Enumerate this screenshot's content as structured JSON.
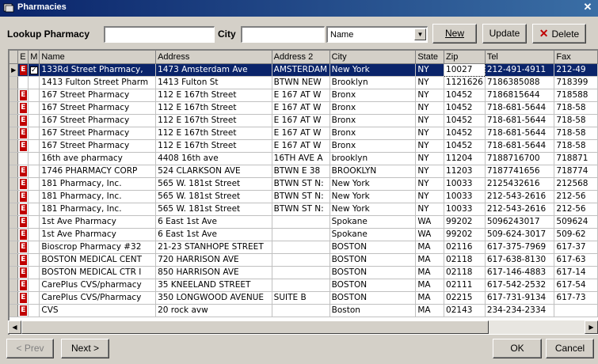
{
  "window": {
    "title": "Pharmacies",
    "close_glyph": "✕"
  },
  "lookup": {
    "label": "Lookup Pharmacy",
    "value": "",
    "city_label": "City",
    "city_value": "",
    "sort_value": "Name"
  },
  "buttons": {
    "new": "New",
    "update": "Update",
    "delete": "Delete",
    "prev": "< Prev",
    "next": "Next >",
    "ok": "OK",
    "cancel": "Cancel"
  },
  "table": {
    "columns": [
      "E",
      "M",
      "Name",
      "Address",
      "Address 2",
      "City",
      "State",
      "Zip",
      "Tel",
      "Fax"
    ],
    "rows": [
      [
        "E",
        "✓",
        "133Rd Street Pharmacy,",
        "1473 Amsterdam Ave",
        "AMSTERDAM",
        "New York",
        "NY",
        "10027",
        "212-491-4911",
        "212-49"
      ],
      [
        "",
        "",
        "1413 Fulton Street Pharm",
        "1413 Fulton St",
        "BTWN NEW",
        "Brooklyn",
        "NY",
        "1121626",
        "7186385088",
        "718399"
      ],
      [
        "E",
        "",
        "167 Street Pharmacy",
        "112 E 167th Street",
        "E 167 AT W",
        "Bronx",
        "NY",
        "10452",
        "7186815644",
        "718588"
      ],
      [
        "E",
        "",
        "167 Street Pharmacy",
        "112 E 167th Street",
        "E 167 AT W",
        "Bronx",
        "NY",
        "10452",
        "718-681-5644",
        "718-58"
      ],
      [
        "E",
        "",
        "167 Street Pharmacy",
        "112 E 167th Street",
        "E 167 AT W",
        "Bronx",
        "NY",
        "10452",
        "718-681-5644",
        "718-58"
      ],
      [
        "E",
        "",
        "167 Street Pharmacy",
        "112 E 167th Street",
        "E 167 AT W",
        "Bronx",
        "NY",
        "10452",
        "718-681-5644",
        "718-58"
      ],
      [
        "E",
        "",
        "167 Street Pharmacy",
        "112 E 167th Street",
        "E 167 AT W",
        "Bronx",
        "NY",
        "10452",
        "718-681-5644",
        "718-58"
      ],
      [
        "",
        "",
        "16th ave pharmacy",
        "4408 16th ave",
        "16TH AVE A",
        "brooklyn",
        "NY",
        "11204",
        "7188716700",
        "718871"
      ],
      [
        "E",
        "",
        "1746 PHARMACY CORP",
        "524 CLARKSON AVE",
        "BTWN E 38",
        "BROOKLYN",
        "NY",
        "11203",
        "7187741656",
        "718774"
      ],
      [
        "E",
        "",
        "181 Pharmacy, Inc.",
        "565 W. 181st Street",
        "BTWN ST N:",
        "New York",
        "NY",
        "10033",
        "2125432616",
        "212568"
      ],
      [
        "E",
        "",
        "181 Pharmacy, Inc.",
        "565 W. 181st Street",
        "BTWN ST N:",
        "New York",
        "NY",
        "10033",
        "212-543-2616",
        "212-56"
      ],
      [
        "E",
        "",
        "181 Pharmacy, Inc.",
        "565 W. 181st Street",
        "BTWN ST N:",
        "New York",
        "NY",
        "10033",
        "212-543-2616",
        "212-56"
      ],
      [
        "E",
        "",
        "1st Ave Pharmacy",
        "6 East 1st Ave",
        "",
        "Spokane",
        "WA",
        "99202",
        "5096243017",
        "509624"
      ],
      [
        "E",
        "",
        "1st Ave Pharmacy",
        "6 East 1st Ave",
        "",
        "Spokane",
        "WA",
        "99202",
        "509-624-3017",
        "509-62"
      ],
      [
        "E",
        "",
        "Bioscrop Pharmacy #32",
        "21-23 STANHOPE STREET",
        "",
        "BOSTON",
        "MA",
        "02116",
        "617-375-7969",
        "617-37"
      ],
      [
        "E",
        "",
        "BOSTON MEDICAL CENT",
        "720 HARRISON AVE",
        "",
        "BOSTON",
        "MA",
        "02118",
        "617-638-8130",
        "617-63"
      ],
      [
        "E",
        "",
        "BOSTON MEDICAL CTR I",
        "850 HARRISON AVE",
        "",
        "BOSTON",
        "MA",
        "02118",
        "617-146-4883",
        "617-14"
      ],
      [
        "E",
        "",
        "CarePlus CVS/pharmacy",
        "35 KNEELAND STREET",
        "",
        "BOSTON",
        "MA",
        "02111",
        "617-542-2532",
        "617-54"
      ],
      [
        "E",
        "",
        "CarePlus CVS/Pharmacy",
        "350 LONGWOOD AVENUE",
        "SUITE B",
        "BOSTON",
        "MA",
        "02215",
        "617-731-9134",
        "617-73"
      ],
      [
        "E",
        "",
        "CVS",
        "20 rock avw",
        "",
        "Boston",
        "MA",
        "02143",
        "234-234-2334",
        ""
      ]
    ]
  }
}
